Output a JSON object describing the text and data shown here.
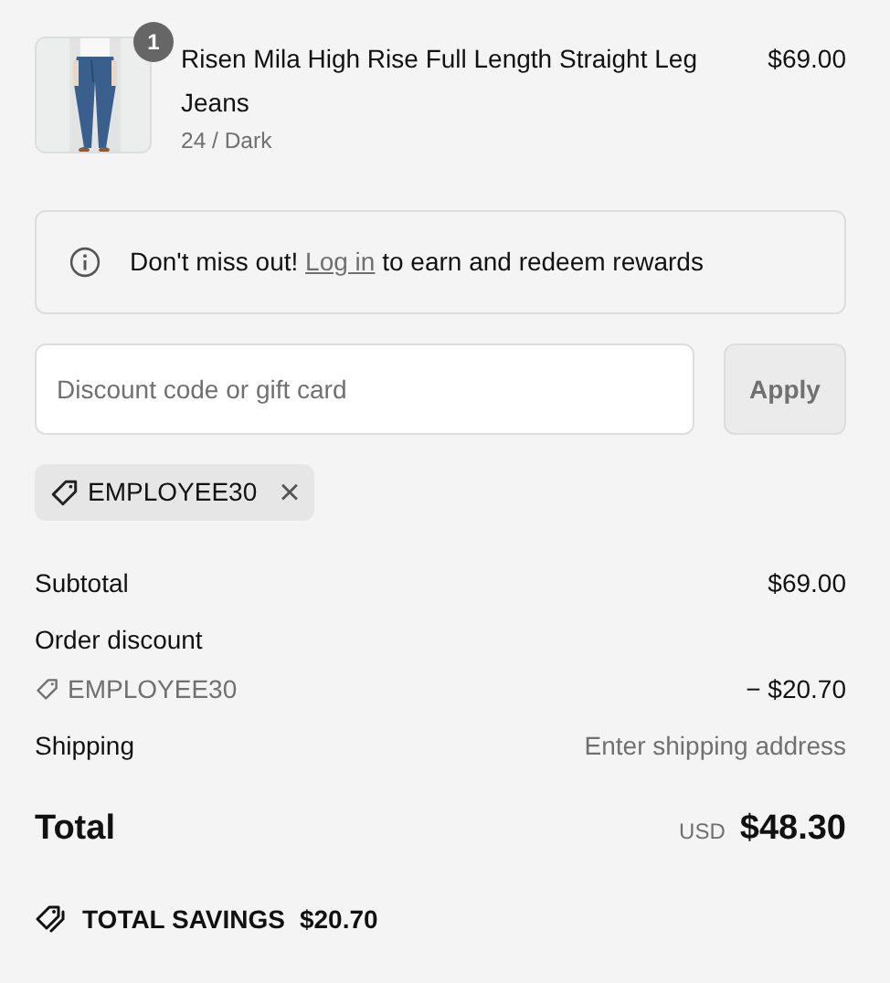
{
  "product": {
    "quantity": "1",
    "name": "Risen Mila High Rise Full Length Straight Leg Jeans",
    "variant": "24 / Dark",
    "price": "$69.00"
  },
  "notice": {
    "before": "Don't miss out!",
    "link": "Log in",
    "after": "to earn and redeem rewards"
  },
  "discount": {
    "placeholder": "Discount code or gift card",
    "button": "Apply"
  },
  "applied_codes": [
    {
      "code": "EMPLOYEE30",
      "remove": "×"
    }
  ],
  "summary": [
    {
      "kind": "line",
      "label": "Subtotal",
      "value": "$69.00"
    },
    {
      "kind": "heading",
      "label": "Order discount"
    },
    {
      "kind": "code",
      "label": "EMPLOYEE30",
      "value": "− $20.70"
    },
    {
      "kind": "muted",
      "label": "Shipping",
      "value": "Enter shipping address"
    }
  ],
  "total": {
    "label": "Total",
    "currency": "USD",
    "amount": "$48.30"
  },
  "savings": {
    "label": "TOTAL SAVINGS",
    "amount": "$20.70"
  }
}
